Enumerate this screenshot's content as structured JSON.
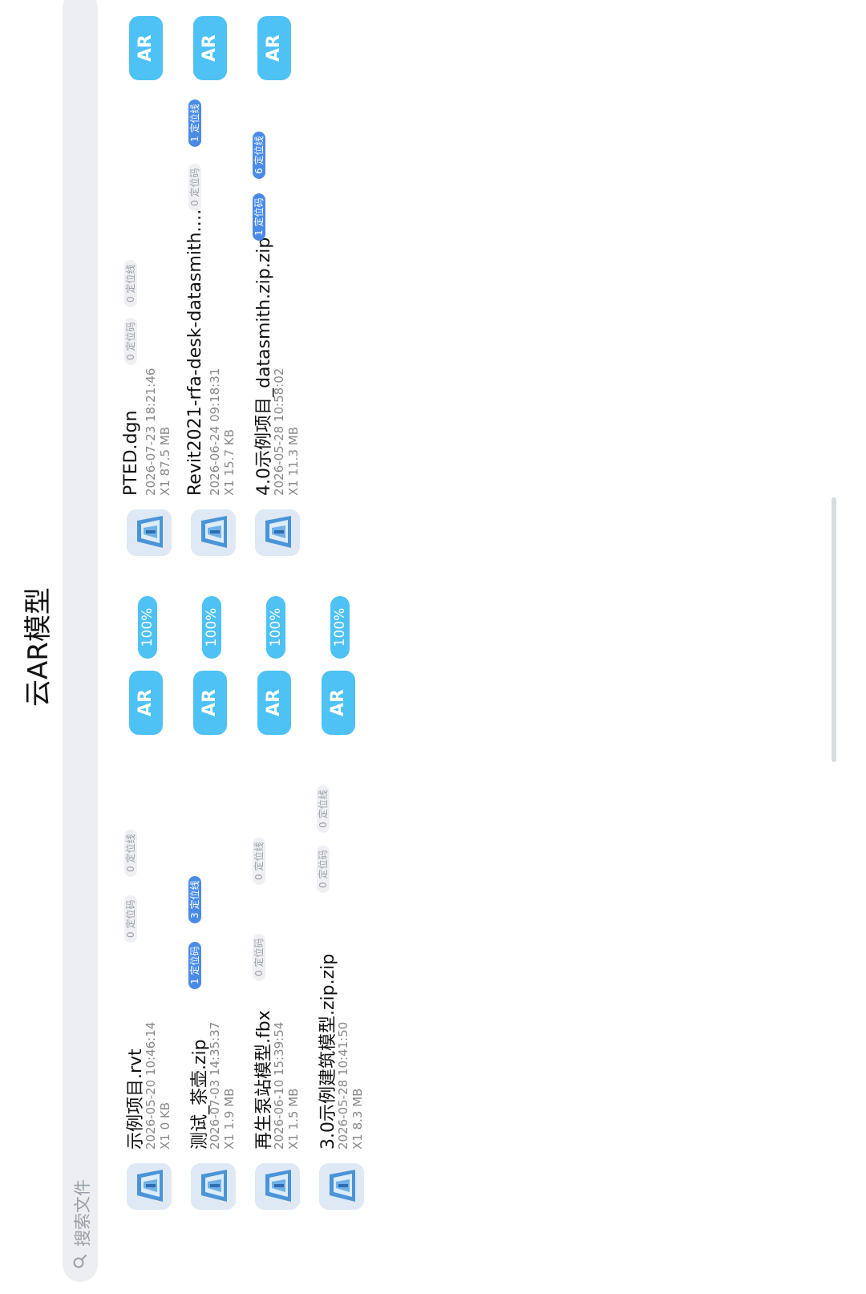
{
  "header": {
    "title": "云AR模型"
  },
  "search": {
    "placeholder": "搜索文件"
  },
  "files": [
    {
      "name": "示例项目.rvt",
      "date": "2026-05-20 10:46:14",
      "size": "X1  0 KB",
      "tag1": "0 定位码",
      "tag2": "0 定位线",
      "tag1_active": false,
      "tag2_active": false,
      "ar": "AR",
      "progress": "100%"
    },
    {
      "name": "PTED.dgn",
      "date": "2026-07-23 18:21:46",
      "size": "X1  87.5 MB",
      "tag1": "0 定位码",
      "tag2": "0 定位线",
      "tag1_active": false,
      "tag2_active": false,
      "ar": "AR",
      "progress": ""
    },
    {
      "name": "测试_茶壶.zip",
      "date": "2026-07-03 14:35:37",
      "size": "X1  1.9 MB",
      "tag1": "1 定位码",
      "tag2": "3 定位线",
      "tag1_active": true,
      "tag2_active": true,
      "ar": "AR",
      "progress": "100%"
    },
    {
      "name": "Revit2021-rfa-desk-datasmith.…",
      "date": "2026-06-24 09:18:31",
      "size": "X1  15.7 KB",
      "tag1": "0 定位码",
      "tag2": "1 定位线",
      "tag1_active": false,
      "tag2_active": true,
      "ar": "AR",
      "progress": ""
    },
    {
      "name": "再生泵站模型.fbx",
      "date": "2026-06-10 15:39:54",
      "size": "X1  1.5 MB",
      "tag1": "0 定位码",
      "tag2": "0 定位线",
      "tag1_active": false,
      "tag2_active": false,
      "ar": "AR",
      "progress": "100%"
    },
    {
      "name": "4.0示例项目_datasmith.zip.zip",
      "date": "2026-05-28 10:58:02",
      "size": "X1  11.3 MB",
      "tag1": "1 定位码",
      "tag2": "6 定位线",
      "tag1_active": true,
      "tag2_active": true,
      "ar": "AR",
      "progress": ""
    },
    {
      "name": "3.0示例建筑模型.zip.zip",
      "date": "2026-05-28 10:41:50",
      "size": "X1  8.3 MB",
      "tag1": "0 定位码",
      "tag2": "0 定位线",
      "tag1_active": false,
      "tag2_active": false,
      "ar": "AR",
      "progress": "100%"
    }
  ]
}
